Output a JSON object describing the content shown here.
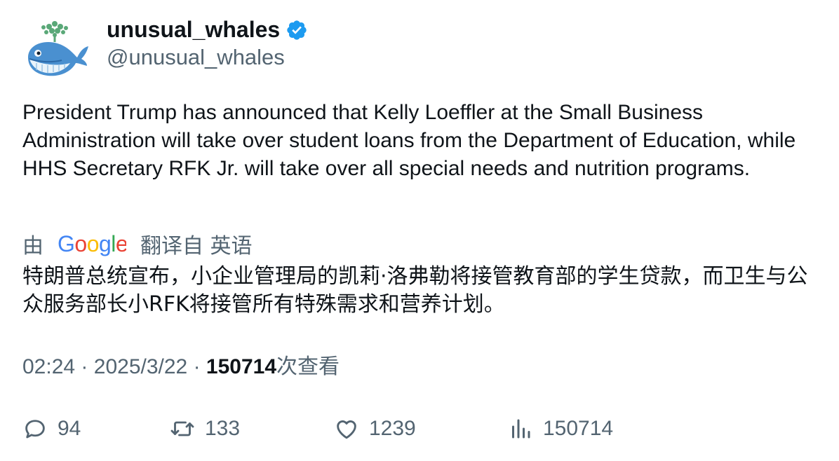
{
  "author": {
    "display_name": "unusual_whales",
    "handle": "@unusual_whales",
    "verified": true,
    "avatar_icon": "whale-avatar-icon"
  },
  "tweet": {
    "text": "President Trump has announced that Kelly Loeffler at the Small Business Administration will take over student loans from the Department of Education, while HHS Secretary RFK Jr. will take over all special needs and nutrition programs."
  },
  "translation": {
    "by_label": "由",
    "provider": "Google",
    "from_label": "翻译自 英语",
    "text": "特朗普总统宣布，小企业管理局的凯莉·洛弗勒将接管教育部的学生贷款，而卫生与公众服务部长小RFK将接管所有特殊需求和营养计划。"
  },
  "meta": {
    "time": "02:24",
    "separator": "·",
    "date": "2025/3/22",
    "views_count": "150714",
    "views_label": "次查看"
  },
  "actions": {
    "replies": "94",
    "retweets": "133",
    "likes": "1239",
    "views": "150714"
  },
  "colors": {
    "text": "#0f1419",
    "secondary": "#536471",
    "verified": "#1d9bf0"
  }
}
